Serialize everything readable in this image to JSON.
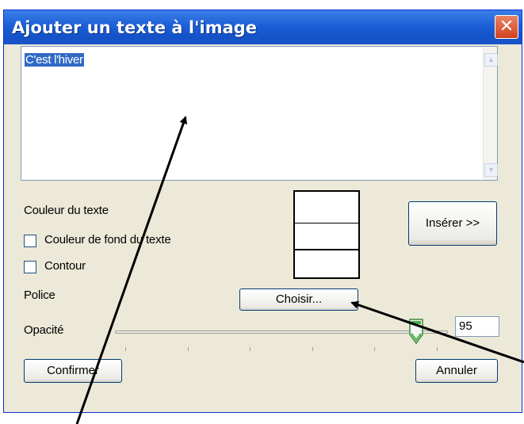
{
  "dialog": {
    "title": "Ajouter un texte à l'image",
    "close_glyph": "✕"
  },
  "text_input": {
    "value": "C'est l'hiver"
  },
  "labels": {
    "text_color": "Couleur du texte",
    "bg_color": "Couleur de fond du texte",
    "outline": "Contour",
    "font": "Police",
    "opacity": "Opacité"
  },
  "checkboxes": {
    "bg_color_checked": false,
    "outline_checked": false
  },
  "buttons": {
    "insert": "Insérer >>",
    "choose": "Choisir...",
    "confirm": "Confirmer",
    "cancel": "Annuler"
  },
  "opacity": {
    "value": "95",
    "slider_fraction": 0.95,
    "tick_count": 6
  },
  "colors": {
    "title_bar": "#1c5fd8",
    "dialog_bg": "#ece9d8",
    "selection": "#316ac5",
    "close_button": "#d4411e",
    "annotation_arrows": "#000000"
  }
}
